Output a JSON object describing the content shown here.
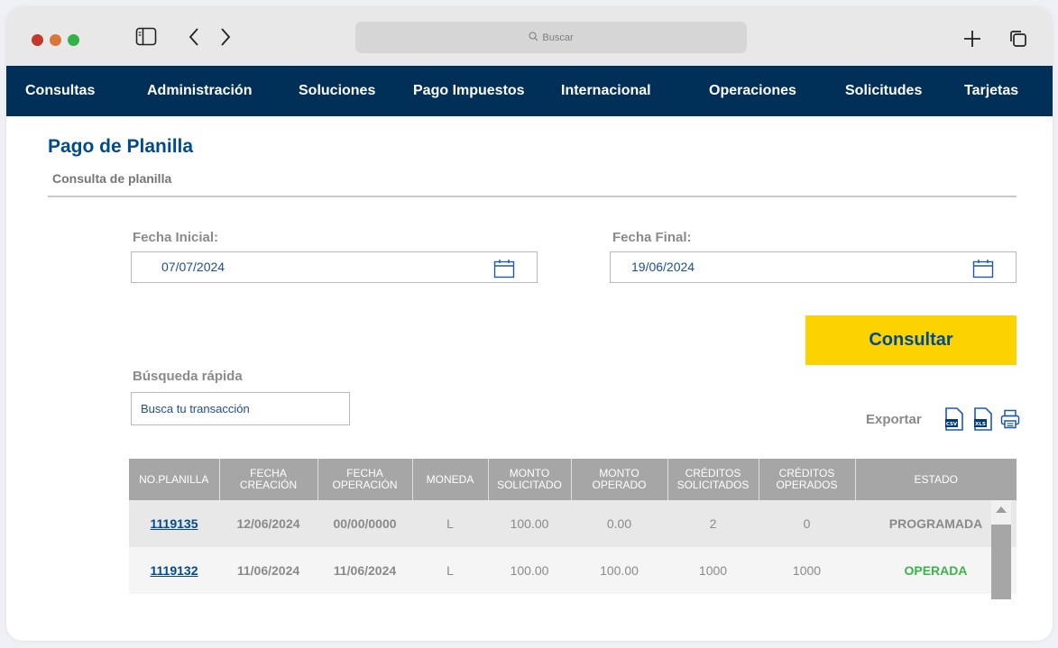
{
  "browser": {
    "search_placeholder": "Buscar"
  },
  "nav": {
    "items": [
      "Consultas",
      "Administración",
      "Soluciones",
      "Pago Impuestos",
      "Internacional",
      "Operaciones",
      "Solicitudes",
      "Tarjetas"
    ]
  },
  "page": {
    "title": "Pago de Planilla",
    "subtitle": "Consulta de planilla"
  },
  "filters": {
    "start_label": "Fecha Inicial:",
    "start_value": "07/07/2024",
    "end_label": "Fecha Final:",
    "end_value": "19/06/2024",
    "submit_label": "Consultar"
  },
  "quick_search": {
    "label": "Búsqueda rápida",
    "placeholder": "Busca tu transacción"
  },
  "export": {
    "label": "Exportar",
    "csv_text": "CSV",
    "xls_text": "XLS"
  },
  "table": {
    "headers": [
      [
        "NO.PLANILLA"
      ],
      [
        "FECHA",
        "CREACIÓN"
      ],
      [
        "FECHA",
        "OPERACIÓN"
      ],
      [
        "MONEDA"
      ],
      [
        "MONTO",
        "SOLICITADO"
      ],
      [
        "MONTO",
        "OPERADO"
      ],
      [
        "CRÉDITOS",
        "SOLICITADOS"
      ],
      [
        "CRÉDITOS",
        "OPERADOS"
      ],
      [
        "ESTADO"
      ]
    ],
    "rows": [
      [
        "1119135",
        "12/06/2024",
        "00/00/0000",
        "L",
        "100.00",
        "0.00",
        "2",
        "0",
        "PROGRAMADA"
      ],
      [
        "1119132",
        "11/06/2024",
        "11/06/2024",
        "L",
        "100.00",
        "100.00",
        "1000",
        "1000",
        "OPERADA"
      ]
    ]
  },
  "colors": {
    "nav_bg": "#003057",
    "accent_blue": "#004a8f",
    "button_yellow": "#fcd200",
    "status_operada": "#3ab54a",
    "table_header": "#a6a6a6"
  }
}
